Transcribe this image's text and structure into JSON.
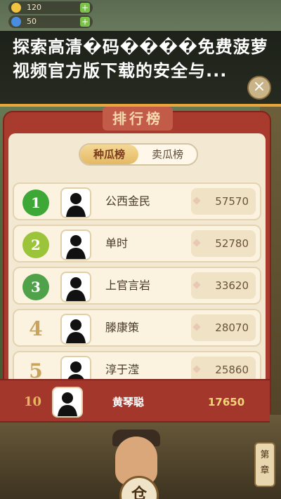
{
  "resources": {
    "coins": "120",
    "gems": "50",
    "plus": "+"
  },
  "overlay": {
    "line1": "探索高清�码����免费菠萝",
    "line2": "视频官方版下载的安全与..."
  },
  "panel": {
    "title": "排行榜",
    "tabs": [
      {
        "label": "种瓜榜",
        "active": true
      },
      {
        "label": "卖瓜榜",
        "active": false
      }
    ],
    "rows": [
      {
        "rank": "1",
        "name": "公西金民",
        "score": "57570",
        "medal": "#3da836"
      },
      {
        "rank": "2",
        "name": "单时",
        "score": "52780",
        "medal": "#9cc43a"
      },
      {
        "rank": "3",
        "name": "上官言岩",
        "score": "33620",
        "medal": "#4fa24a"
      },
      {
        "rank": "4",
        "name": "滕康策",
        "score": "28070",
        "medal": ""
      },
      {
        "rank": "5",
        "name": "淳于滢",
        "score": "25860",
        "medal": ""
      }
    ]
  },
  "me": {
    "rank": "10",
    "name": "黄琴聪",
    "score": "17650"
  },
  "scene": {
    "warehouse_label": "仓",
    "chapter_label1": "第",
    "chapter_label2": "章",
    "close_symbol": "×"
  }
}
